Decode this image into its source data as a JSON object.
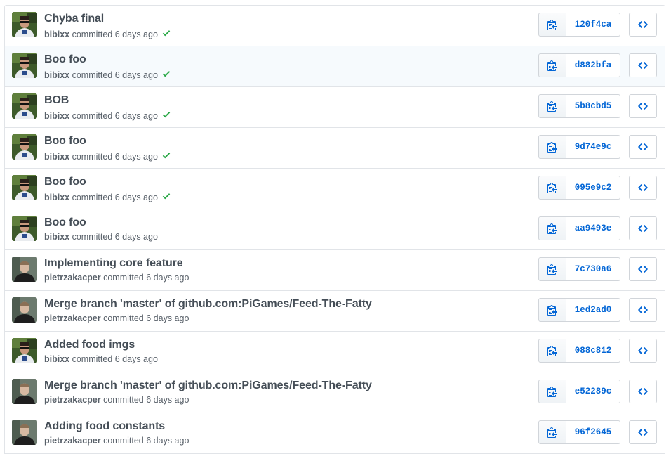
{
  "commits": [
    {
      "title": "Chyba final",
      "author": "bibixx",
      "committed": "committed",
      "time": "6 days ago",
      "status": "success",
      "sha": "120f4ca",
      "avatar": "bibixx-avatar"
    },
    {
      "title": "Boo foo",
      "author": "bibixx",
      "committed": "committed",
      "time": "6 days ago",
      "status": "success",
      "sha": "d882bfa",
      "avatar": "bibixx-avatar"
    },
    {
      "title": "BOB",
      "author": "bibixx",
      "committed": "committed",
      "time": "6 days ago",
      "status": "success",
      "sha": "5b8cbd5",
      "avatar": "bibixx-avatar"
    },
    {
      "title": "Boo foo",
      "author": "bibixx",
      "committed": "committed",
      "time": "6 days ago",
      "status": "success",
      "sha": "9d74e9c",
      "avatar": "bibixx-avatar"
    },
    {
      "title": "Boo foo",
      "author": "bibixx",
      "committed": "committed",
      "time": "6 days ago",
      "status": "success",
      "sha": "095e9c2",
      "avatar": "bibixx-avatar"
    },
    {
      "title": "Boo foo",
      "author": "bibixx",
      "committed": "committed",
      "time": "6 days ago",
      "status": "none",
      "sha": "aa9493e",
      "avatar": "bibixx-avatar"
    },
    {
      "title": "Implementing core feature",
      "author": "pietrzakacper",
      "committed": "committed",
      "time": "6 days ago",
      "status": "none",
      "sha": "7c730a6",
      "avatar": "pietrzakacper-avatar"
    },
    {
      "title": "Merge branch 'master' of github.com:PiGames/Feed-The-Fatty",
      "author": "pietrzakacper",
      "committed": "committed",
      "time": "6 days ago",
      "status": "none",
      "sha": "1ed2ad0",
      "avatar": "pietrzakacper-avatar"
    },
    {
      "title": "Added food imgs",
      "author": "bibixx",
      "committed": "committed",
      "time": "6 days ago",
      "status": "none",
      "sha": "088c812",
      "avatar": "bibixx-avatar"
    },
    {
      "title": "Merge branch 'master' of github.com:PiGames/Feed-The-Fatty",
      "author": "pietrzakacper",
      "committed": "committed",
      "time": "6 days ago",
      "status": "none",
      "sha": "e52289c",
      "avatar": "pietrzakacper-avatar"
    },
    {
      "title": "Adding food constants",
      "author": "pietrzakacper",
      "committed": "committed",
      "time": "6 days ago",
      "status": "none",
      "sha": "96f2645",
      "avatar": "pietrzakacper-avatar"
    }
  ],
  "highlighted_row": 1,
  "icons": {
    "copy": "clipboard-icon",
    "browse": "code-icon",
    "status_success": "check-icon"
  },
  "colors": {
    "sha_link": "#0366d6",
    "success": "#28a745",
    "title": "#444d56",
    "meta": "#586069"
  }
}
